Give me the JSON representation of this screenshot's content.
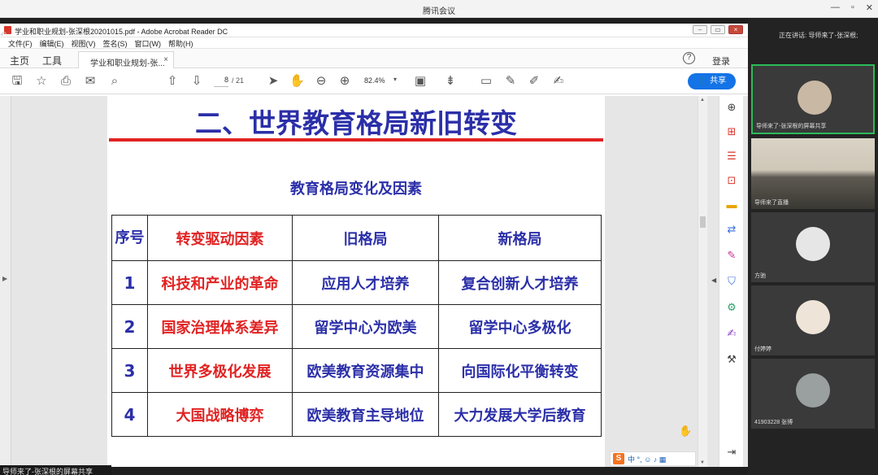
{
  "window": {
    "title": "腾讯会议",
    "controls": [
      "—",
      "▫",
      "✕"
    ]
  },
  "acrobat": {
    "title": "学业和职业规划-张深根20201015.pdf - Adobe Acrobat Reader DC",
    "menu": [
      "文件(F)",
      "编辑(E)",
      "视图(V)",
      "签名(S)",
      "窗口(W)",
      "帮助(H)"
    ],
    "tabs": {
      "home": "主页",
      "tools": "工具",
      "doc": "学业和职业规划-张...",
      "close": "×"
    },
    "help": "?",
    "login": "登录",
    "page_current": "8",
    "page_total": "/ 21",
    "zoom": "82.4%",
    "share": "共享"
  },
  "slide": {
    "title": "二、世界教育格局新旧转变",
    "subtitle": "教育格局变化及因素",
    "header": [
      "序号",
      "转变驱动因素",
      "旧格局",
      "新格局"
    ],
    "rows": [
      [
        "1",
        "科技和产业的革命",
        "应用人才培养",
        "复合创新人才培养"
      ],
      [
        "2",
        "国家治理体系差异",
        "留学中心为欧美",
        "留学中心多极化"
      ],
      [
        "3",
        "世界多极化发展",
        "欧美教育资源集中",
        "向国际化平衡转变"
      ],
      [
        "4",
        "大国战略博弈",
        "欧美教育主导地位",
        "大力发展大学后教育"
      ]
    ]
  },
  "ime": {
    "logo": "S",
    "text": "中 °, ☺ ♪ ▦"
  },
  "share_status": "导师来了-张深根的屏幕共享",
  "sidebar": {
    "talking": "正在讲话: 导师来了-张深根;",
    "participants": [
      {
        "label": "导师来了-张深根的屏幕共享"
      },
      {
        "label": "导师来了直播"
      },
      {
        "label": "方驰"
      },
      {
        "label": "付婷婷"
      },
      {
        "label": "41903228 张博"
      }
    ]
  },
  "colors": {
    "title_blue": "#2b2fa8",
    "accent_red": "#e12222",
    "share_blue": "#1473e6",
    "active_green": "#2bbb5a"
  }
}
